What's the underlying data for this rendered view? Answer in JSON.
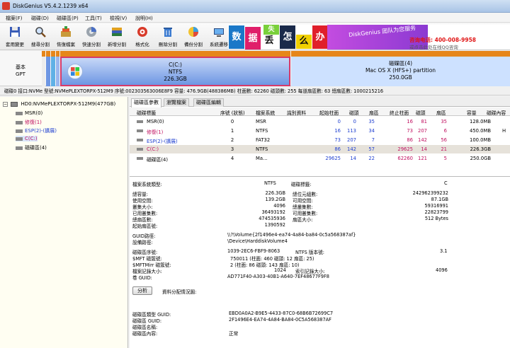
{
  "window": {
    "title": "DiskGenius V5.4.2.1239 x64"
  },
  "menu": [
    "檔案(F)",
    "磁碟(D)",
    "磁碟區(P)",
    "工具(T)",
    "檢視(V)",
    "說明(H)"
  ],
  "toolbar": [
    {
      "label": "套用變更",
      "icon": "save-icon"
    },
    {
      "label": "搜尋分割",
      "icon": "search-icon"
    },
    {
      "label": "恢復檔案",
      "icon": "recover-icon"
    },
    {
      "label": "快速分割",
      "icon": "quick-partition-icon"
    },
    {
      "label": "新增分割",
      "icon": "new-partition-icon"
    },
    {
      "label": "格式化",
      "icon": "format-icon"
    },
    {
      "label": "刪除分割",
      "icon": "delete-icon"
    },
    {
      "label": "備份分割",
      "icon": "backup-icon"
    },
    {
      "label": "系統遷移",
      "icon": "migrate-icon"
    }
  ],
  "banner": {
    "chars": [
      "数",
      "据",
      "丢",
      "失",
      "怎",
      "么",
      "办"
    ],
    "slogan": "DiskGenius 团队为您服务",
    "phone": "咨询电话: 400-008-9958",
    "qq": "或点击此处在线QQ咨询"
  },
  "diskmap": {
    "label_line1": "基本",
    "label_line2": "GPT",
    "c": {
      "name": "C(C:)",
      "fs": "NTFS",
      "size": "226.3GB"
    },
    "mac": {
      "name": "磁碟區(4)",
      "fs": "Mac OS X (HFS+) partition",
      "size": "250.0GB"
    }
  },
  "infobar": "磁碟0 接口:NVMe  型號:NVMePLEXTORPX-512M9  序號:002303563006E8F9  容量: 476.9GB(488386MB)  柱面數: 62260  磁頭數: 255  每道扇區數: 63  總扇區數: 1000215216",
  "tree": {
    "disk": "HD0:NVMePLEXTORPX-512M9(477GB)",
    "partitions": [
      "MSR(0)",
      "修復(1)",
      "ESP(2)-(擴展)",
      "C(C:)",
      "磁碟區(4)"
    ]
  },
  "tabs": [
    "磁碟區參數",
    "瀏覽檔案",
    "磁碟區編輯"
  ],
  "table": {
    "headers": [
      "磁碟標籤",
      "序號 (狀態)",
      "檔案系統",
      "識別資料",
      "起始柱面",
      "磁頭",
      "扇區",
      "終止柱面",
      "磁頭",
      "扇區",
      "容量",
      "磁碟內容"
    ],
    "rows": [
      {
        "name": "MSR(0)",
        "seq": "0",
        "fs": "MSR",
        "c1": "0",
        "h1": "0",
        "s1": "35",
        "c2": "16",
        "h2": "81",
        "s2": "35",
        "size": "128.0MB",
        "attr": ""
      },
      {
        "name": "修復(1)",
        "seq": "1",
        "fs": "NTFS",
        "c1": "16",
        "h1": "113",
        "s1": "34",
        "c2": "73",
        "h2": "207",
        "s2": "6",
        "size": "450.0MB",
        "attr": "H"
      },
      {
        "name": "ESP(2)-(擴展)",
        "seq": "2",
        "fs": "FAT32",
        "c1": "73",
        "h1": "207",
        "s1": "7",
        "c2": "86",
        "h2": "142",
        "s2": "56",
        "size": "100.0MB",
        "attr": ""
      },
      {
        "name": "C(C:)",
        "seq": "3",
        "fs": "NTFS",
        "c1": "86",
        "h1": "142",
        "s1": "57",
        "c2": "29625",
        "h2": "14",
        "s2": "21",
        "size": "226.3GB",
        "attr": ""
      },
      {
        "name": "磁碟區(4)",
        "seq": "4",
        "fs": "Ma...",
        "c1": "29625",
        "h1": "14",
        "s1": "22",
        "c2": "62260",
        "h2": "121",
        "s2": "5",
        "size": "250.0GB",
        "attr": ""
      }
    ]
  },
  "details": {
    "fs_type_label": "檔案系統類型:",
    "fs_type": "NTFS",
    "vol_label_label": "磁碟標籤:",
    "vol_label": "C",
    "left": [
      [
        "總容量:",
        "226.3GB"
      ],
      [
        "使用空間:",
        "139.2GB"
      ],
      [
        "叢集大小:",
        "4096"
      ],
      [
        "已用叢集數:",
        "36493192"
      ],
      [
        "總扇區數:",
        "474535936"
      ],
      [
        "起始扇區號:",
        "1390592"
      ]
    ],
    "right": [
      [
        "總位元組數:",
        "242962399232"
      ],
      [
        "可用空間:",
        "87.1GB"
      ],
      [
        "總叢集數:",
        "59316991"
      ],
      [
        "可用叢集數:",
        "22823799"
      ],
      [
        "扇區大小:",
        "512 Bytes"
      ]
    ],
    "guid_path_label": "GUID路徑:",
    "guid_path": "\\\\?\\Volume{2f1496e4-ea74-4a84-ba84-0c5a568387af}",
    "device_path_label": "設備路徑:",
    "device_path": "\\Device\\HarddiskVolume4",
    "serial_label": "磁碟區序號:",
    "serial": "1039-2EC6-FBF9-8063",
    "ntfs_ver_label": "NTFS 版本號:",
    "ntfs_ver": "3.1",
    "mft_label": "$MFT 磁簇號:",
    "mft": "750011 (柱面: 460 磁頭: 12 扇區: 25)",
    "mftmirr_label": "$MFTMirr 磁簇號:",
    "mftmirr": "2 (柱面: 86 磁頭: 143 扇區: 10)",
    "rec_label": "檔案記錄大小:",
    "rec": "1024",
    "idx_label": "索引記錄大小:",
    "idx": "4096",
    "volguid_label": "卷 GUID:",
    "volguid": "AD771F40-A303-40B1-A640-7EF48677F9F8",
    "analyze_button": "分析",
    "alloc_label": "資料分配情況圖:",
    "type_guid_label": "磁碟區類型 GUID:",
    "type_guid": "EBD0A0A2-B9E5-4433-87C0-68B6B72699C7",
    "part_guid_label": "磁碟區 GUID:",
    "part_guid": "2F1496E4-EA74-4A84-BA84-0C5A568387AF",
    "part_name_label": "磁碟區名稱:",
    "part_name": "",
    "part_attr_label": "磁碟區內容:",
    "part_attr": "正常"
  },
  "colors": {
    "accent": "#2040d0",
    "c_border": "#d63a6a",
    "ntfs_blue": "#6d96e3",
    "mac_blue": "#cde1ff",
    "tree_bg": "#fffef2"
  }
}
